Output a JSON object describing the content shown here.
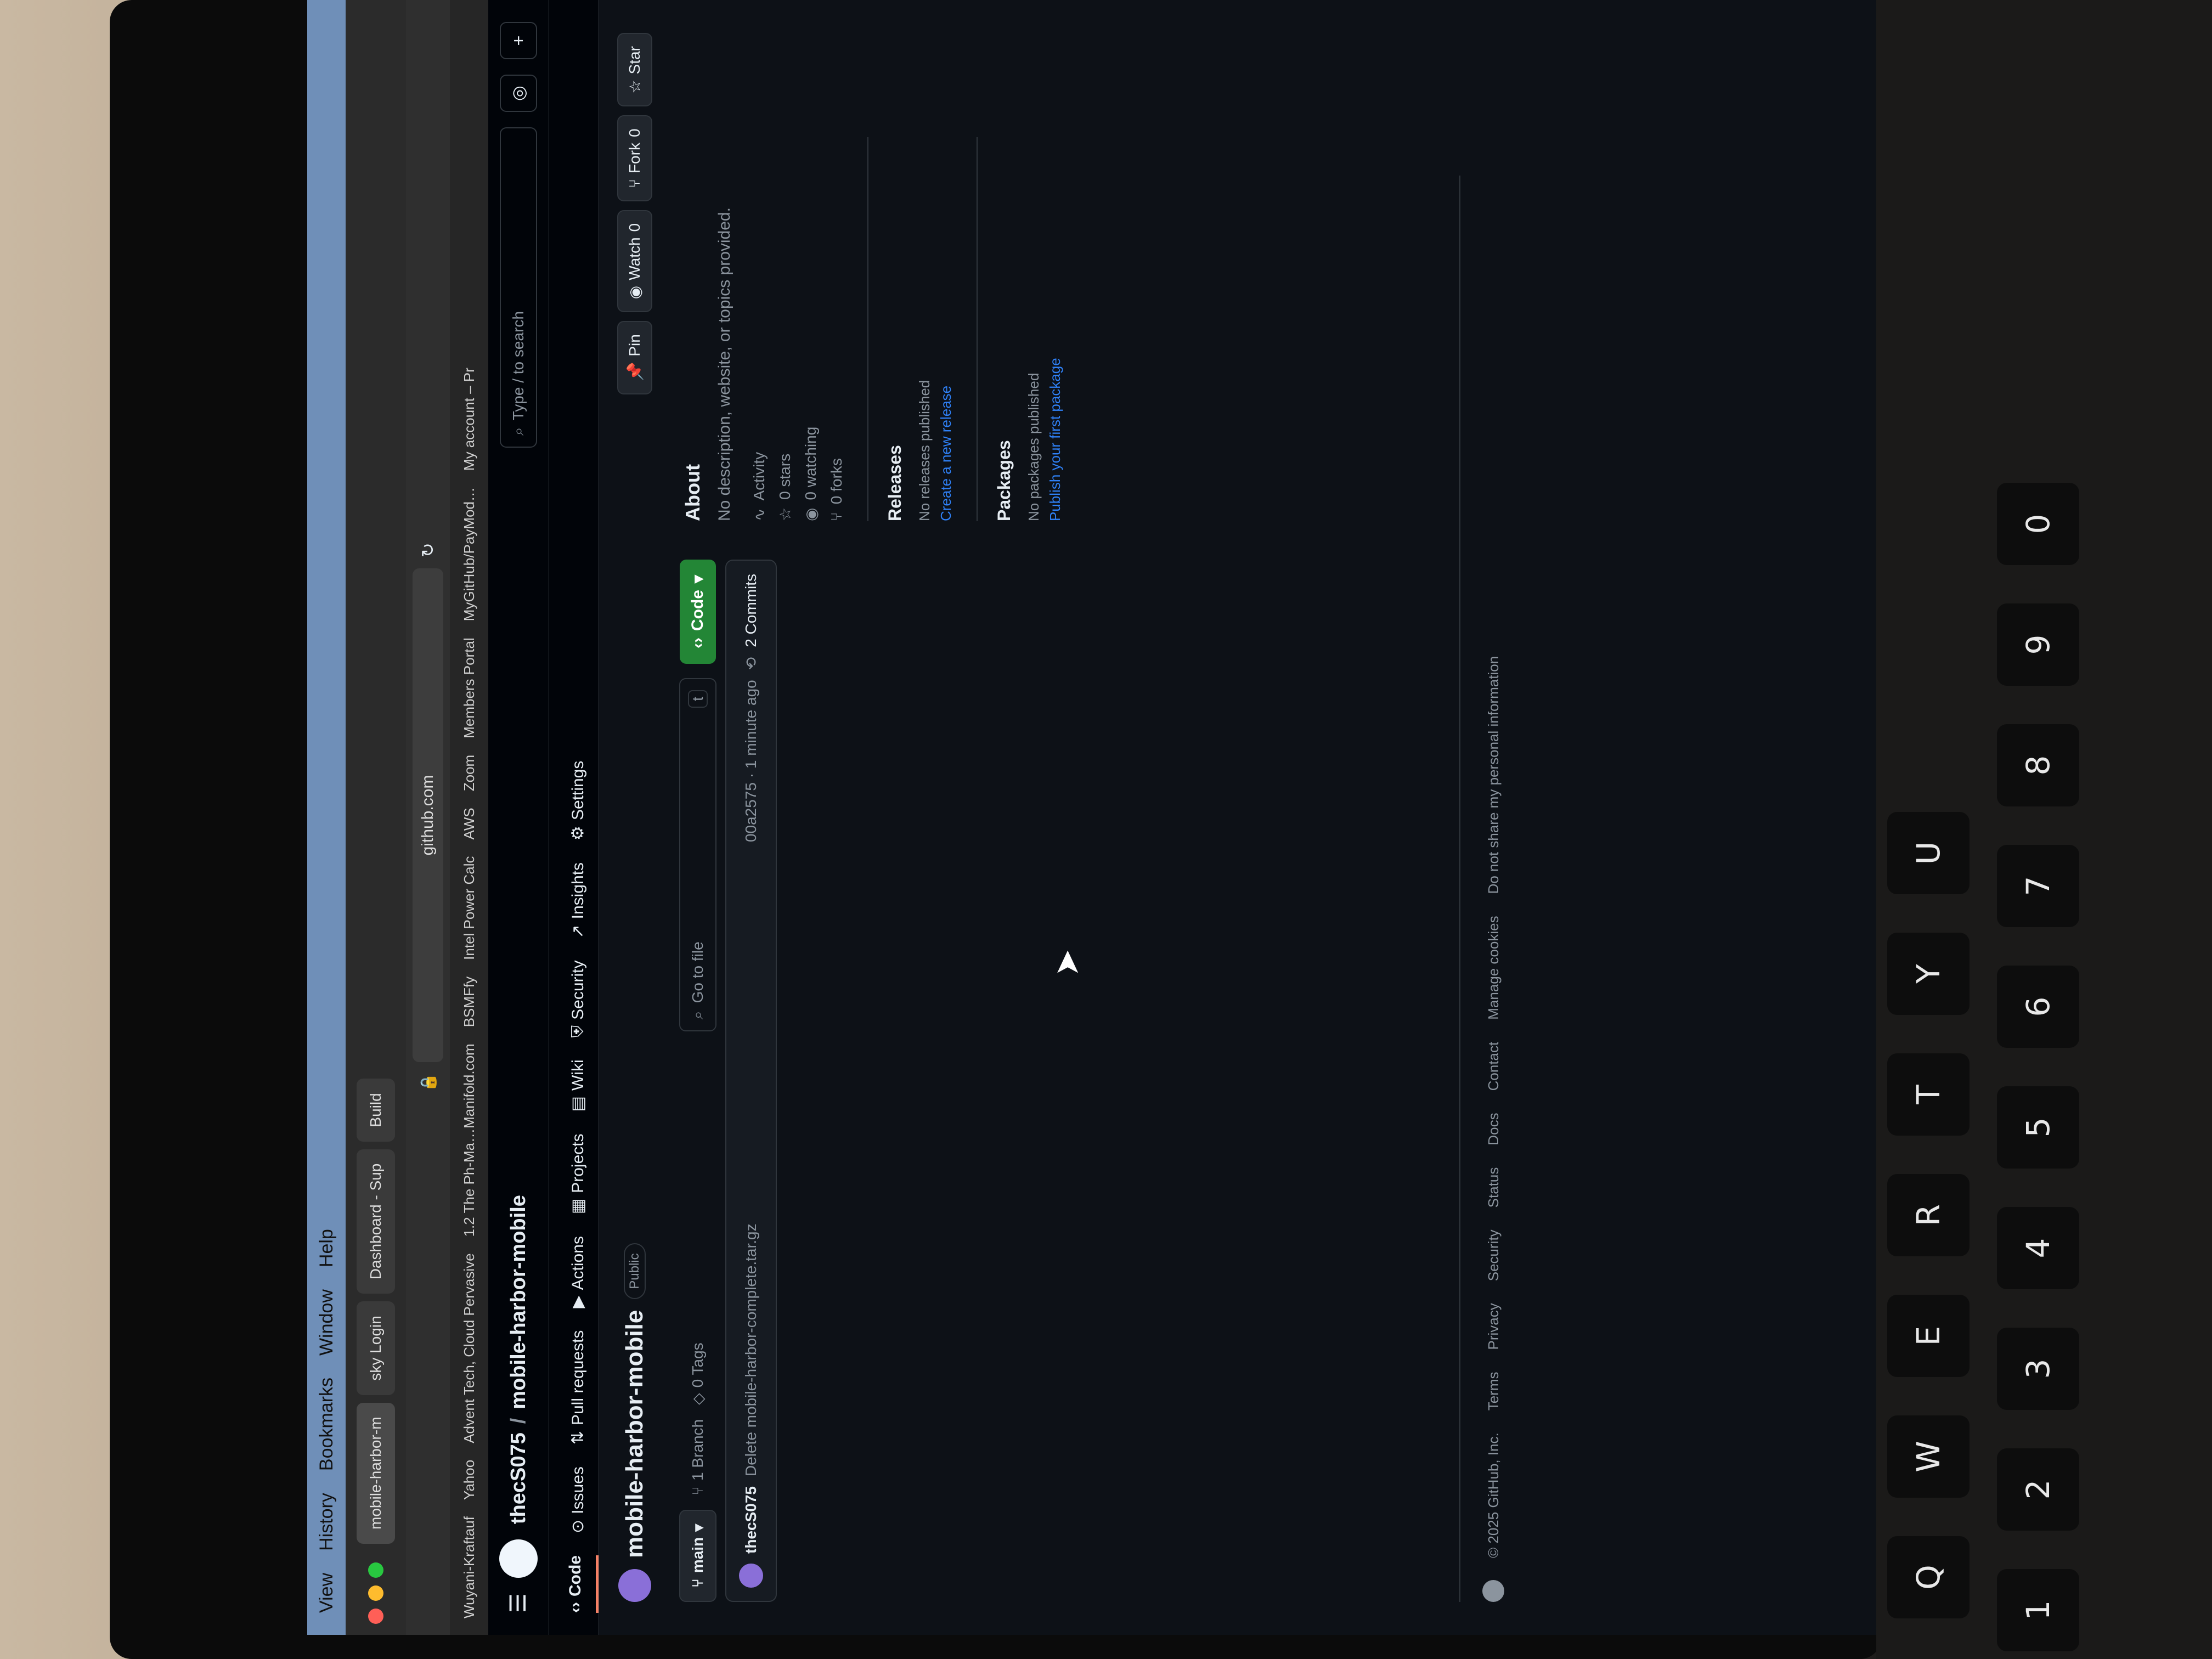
{
  "menu": {
    "items": [
      "View",
      "History",
      "Bookmarks",
      "Window",
      "Help"
    ]
  },
  "tabs": [
    {
      "label": "mobile-harbor-m"
    },
    {
      "label": "sky Login"
    },
    {
      "label": "Dashboard - Sup"
    },
    {
      "label": "Build"
    }
  ],
  "url": {
    "value": "github.com"
  },
  "bookmarks": [
    "Wuyani-Kraftauf",
    "Yahoo",
    "Advent Tech, Cloud Pervasive",
    "1.2 The Ph-Ma…Manifold.com",
    "BSMFfy",
    "Intel Power Calc",
    "AWS",
    "Zoom",
    "Members Portal",
    "MyGitHub/PayMod…",
    "My account – Pr"
  ],
  "header": {
    "owner": "thecS075",
    "sep": "/",
    "repo": "mobile-harbor-mobile",
    "search_placeholder": "Type / to search"
  },
  "repo_nav": [
    {
      "label": "Code",
      "icon": "code-icon"
    },
    {
      "label": "Issues",
      "icon": "issue-icon"
    },
    {
      "label": "Pull requests",
      "icon": "pr-icon"
    },
    {
      "label": "Actions",
      "icon": "play-icon"
    },
    {
      "label": "Projects",
      "icon": "table-icon"
    },
    {
      "label": "Wiki",
      "icon": "book-icon"
    },
    {
      "label": "Security",
      "icon": "shield-icon"
    },
    {
      "label": "Insights",
      "icon": "graph-icon"
    },
    {
      "label": "Settings",
      "icon": "gear-icon"
    }
  ],
  "repo": {
    "title": "mobile-harbor-mobile",
    "visibility": "Public",
    "pin_label": "Pin",
    "watch_label": "Watch",
    "watch_count": "0",
    "fork_label": "Fork",
    "fork_count": "0",
    "star_label": "Star"
  },
  "toolbar": {
    "branch": "main",
    "branches": "1 Branch",
    "tags": "0 Tags",
    "goto_placeholder": "Go to file",
    "goto_key": "t",
    "code_label": "Code"
  },
  "commit": {
    "author": "thecS075",
    "message": "Delete mobile-harbor-complete.tar.gz",
    "sha": "00a2575 · 1 minute ago",
    "count": "2 Commits"
  },
  "about": {
    "heading": "About",
    "description": "No description, website, or topics provided.",
    "stats": [
      {
        "icon": "pulse-icon",
        "label": "Activity"
      },
      {
        "icon": "star-icon",
        "label": "0 stars"
      },
      {
        "icon": "eye-icon",
        "label": "0 watching"
      },
      {
        "icon": "fork-icon",
        "label": "0 forks"
      }
    ]
  },
  "releases": {
    "heading": "Releases",
    "muted": "No releases published",
    "link": "Create a new release"
  },
  "packages": {
    "heading": "Packages",
    "muted": "No packages published",
    "link": "Publish your first package"
  },
  "footer": {
    "copyright": "© 2025 GitHub, Inc.",
    "links": [
      "Terms",
      "Privacy",
      "Security",
      "Status",
      "Docs",
      "Contact",
      "Manage cookies",
      "Do not share my personal information"
    ]
  },
  "keyboard": {
    "keys": [
      "Q",
      "W",
      "E",
      "R",
      "T",
      "Y",
      "U",
      "1",
      "2",
      "3",
      "4",
      "5",
      "6",
      "7",
      "8",
      "9",
      "0"
    ]
  },
  "colors": {
    "accent": "#f78166",
    "code_button": "#238636",
    "link": "#2f81f7",
    "bg": "#0d1117"
  }
}
